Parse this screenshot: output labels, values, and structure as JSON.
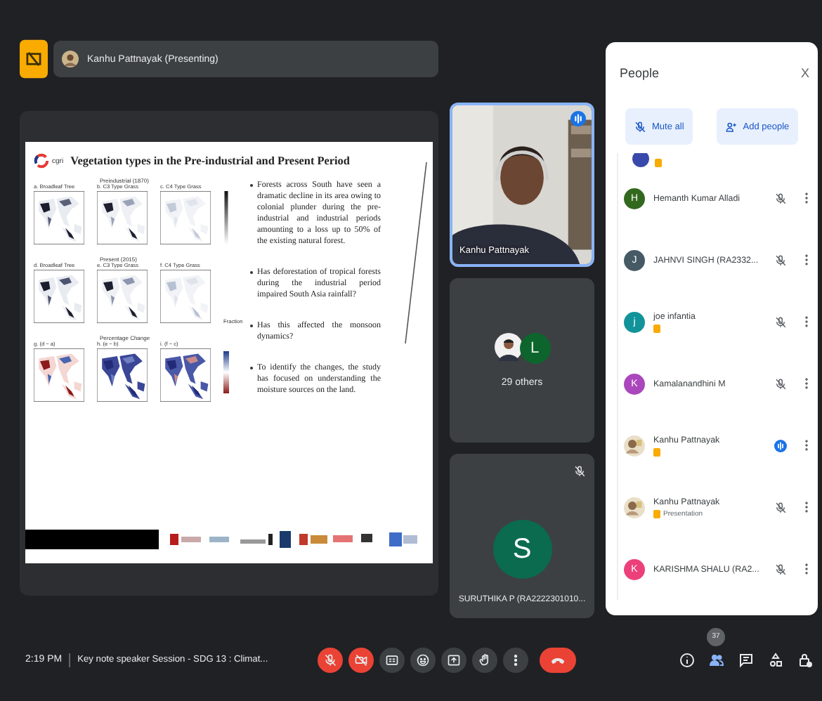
{
  "presenter_bar": {
    "label": "Kanhu Pattnayak (Presenting)"
  },
  "slide": {
    "logo_text": "cgri",
    "title": "Vegetation types in the Pre-industrial and Present Period",
    "map_headers": [
      "Preindustrial (1870)",
      "Present (2015)",
      "Percentage Change"
    ],
    "maps": [
      "a. Broadleaf Tree",
      "b. C3 Type Grass",
      "c. C4 Type Grass",
      "d. Broadleaf Tree",
      "e. C3 Type Grass",
      "f. C4 Type Grass",
      "g. (d − a)",
      "h. (e − b)",
      "i. (f − c)"
    ],
    "colorbar_label": "Fraction",
    "bullets": [
      "Forests across South have seen a dramatic decline in its area owing to colonial plunder during the pre-industrial and industrial periods amounting to a loss up to 50% of the existing natural forest.",
      "Has deforestation of tropical forests during the industrial period impaired South Asia rainfall?",
      "Has this affected the monsoon dynamics?",
      "To identify the changes, the study has focused on understanding the moisture sources on the land."
    ]
  },
  "tiles": [
    {
      "kind": "video",
      "name": "Kanhu Pattnayak",
      "speaking": true
    },
    {
      "kind": "group",
      "letter": "L",
      "color": "#0d652d",
      "label": "29 others"
    },
    {
      "kind": "avatar",
      "letter": "S",
      "color": "#0b6b4f",
      "name": "SURUTHIKA P (RA2222301010...",
      "muted": true
    }
  ],
  "people": {
    "title": "People",
    "close": "X",
    "buttons": [
      "Mute all",
      "Add people"
    ],
    "participants": [
      {
        "kind": "partial",
        "color": "#3949ab",
        "presenting": true
      },
      {
        "kind": "letter",
        "letter": "H",
        "color": "#33691e",
        "name": "Hemanth Kumar Alladi",
        "presenting": false,
        "muted": true
      },
      {
        "kind": "letter",
        "letter": "J",
        "color": "#455a64",
        "name": "JAHNVI SINGH (RA2332...",
        "presenting": false,
        "muted": true
      },
      {
        "kind": "letter",
        "letter": "j",
        "color": "#12939a",
        "name": "joe infantia",
        "presenting": true,
        "muted": true
      },
      {
        "kind": "letter",
        "letter": "K",
        "color": "#ab47bc",
        "name": "Kamalanandhini M",
        "presenting": false,
        "muted": true
      },
      {
        "name": "Kanhu Pattnayak",
        "presenting": true,
        "muted": false
      },
      {
        "name": "Kanhu Pattnayak",
        "presenting": true,
        "caption": "Presentation",
        "muted": true
      },
      {
        "kind": "letter",
        "letter": "K",
        "color": "#ec407a",
        "name": "KARISHMA SHALU (RA2...",
        "presenting": false,
        "muted": true
      }
    ]
  },
  "footer": {
    "time": "2:19 PM",
    "meeting": "Key note speaker Session - SDG 13 : Climat...",
    "controls": [
      {
        "kind": "mic",
        "off": true
      },
      {
        "kind": "camera",
        "off": true
      },
      {
        "kind": "captions",
        "off": false
      },
      {
        "kind": "emoji",
        "off": false
      },
      {
        "kind": "present",
        "off": false
      },
      {
        "kind": "hand",
        "off": false
      },
      {
        "kind": "more",
        "off": false
      },
      {
        "kind": "end"
      }
    ],
    "side": [
      {
        "kind": "info",
        "selected": false
      },
      {
        "kind": "people",
        "selected": true,
        "badge": "37"
      },
      {
        "kind": "chat",
        "selected": false
      },
      {
        "kind": "activities",
        "selected": false
      },
      {
        "kind": "host",
        "selected": false
      }
    ]
  }
}
